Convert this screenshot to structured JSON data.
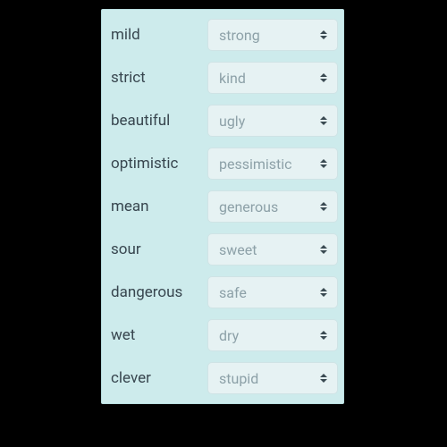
{
  "pairs": [
    {
      "word": "mild",
      "answer": "strong"
    },
    {
      "word": "strict",
      "answer": "kind"
    },
    {
      "word": "beautiful",
      "answer": "ugly"
    },
    {
      "word": "optimistic",
      "answer": "pessimistic"
    },
    {
      "word": "mean",
      "answer": "generous"
    },
    {
      "word": "sour",
      "answer": "sweet"
    },
    {
      "word": "dangerous",
      "answer": "safe"
    },
    {
      "word": "wet",
      "answer": "dry"
    },
    {
      "word": "clever",
      "answer": "stupid"
    }
  ]
}
